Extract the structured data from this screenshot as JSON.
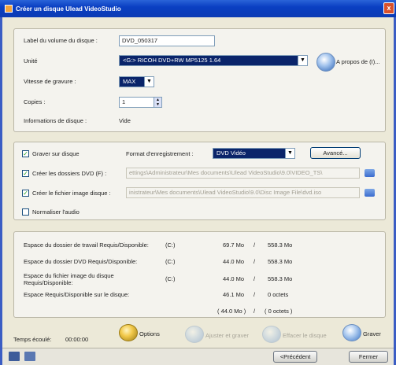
{
  "window": {
    "title": "Créer un disque Ulead VideoStudio",
    "close_label": "x"
  },
  "disc": {
    "label_caption": "Label du volume du disque :",
    "label_value": "DVD_050317",
    "unit_caption": "Unité",
    "unit_value": "<G:> RICOH DVD+RW MP5125  1.64",
    "about_label": "A propos de (I)...",
    "speed_caption": "Vitesse de gravure :",
    "speed_value": "MAX",
    "copies_caption": "Copies :",
    "copies_value": "1",
    "info_caption": "Informations de disque :",
    "info_value": "Vide"
  },
  "options": {
    "burn_label": "Graver sur disque",
    "burn_checked": true,
    "format_caption": "Format d'enregistrement :",
    "format_value": "DVD Vidéo",
    "advanced_label": "Avancé...",
    "dvd_folder_label": "Créer les dossiers DVD (F) :",
    "dvd_folder_checked": true,
    "dvd_folder_path": "ettings\\Administrateur\\Mes documents\\Ulead VideoStudio\\9.0\\VIDEO_TS\\",
    "image_label": "Créer le fichier image disque :",
    "image_checked": true,
    "image_path": "inistrateur\\Mes documents\\Ulead VideoStudio\\9.0\\Disc Image File\\dvd.iso",
    "normalize_label": "Normaliser l'audio",
    "normalize_checked": false
  },
  "space": {
    "rows": [
      {
        "caption": "Espace du dossier de travail Requis/Disponible:",
        "drive": "(C:)",
        "required": "69.7 Mo",
        "sep": "/",
        "available": "558.3 Mo"
      },
      {
        "caption": "Espace du dossier DVD Requis/Disponible:",
        "drive": "(C:)",
        "required": "44.0 Mo",
        "sep": "/",
        "available": "558.3 Mo"
      },
      {
        "caption": "Espace du fichier image du disque Requis/Disponible:",
        "drive": "(C:)",
        "required": "44.0 Mo",
        "sep": "/",
        "available": "558.3 Mo"
      },
      {
        "caption": "Espace Requis/Disponible sur le disque:",
        "drive": "",
        "required": "46.1 Mo",
        "sep": "/",
        "available": "0 octets"
      }
    ],
    "total_required": "( 44.0 Mo )",
    "total_sep": "/",
    "total_available": "( 0 octets )"
  },
  "footer": {
    "elapsed_caption": "Temps écoulé:",
    "elapsed_value": "00:00:00",
    "options_label": "Options",
    "adjust_label": "Ajuster et graver",
    "erase_label": "Effacer le disque",
    "burn_label": "Graver",
    "prev_label": "<Précédent",
    "close_label": "Fermer"
  }
}
